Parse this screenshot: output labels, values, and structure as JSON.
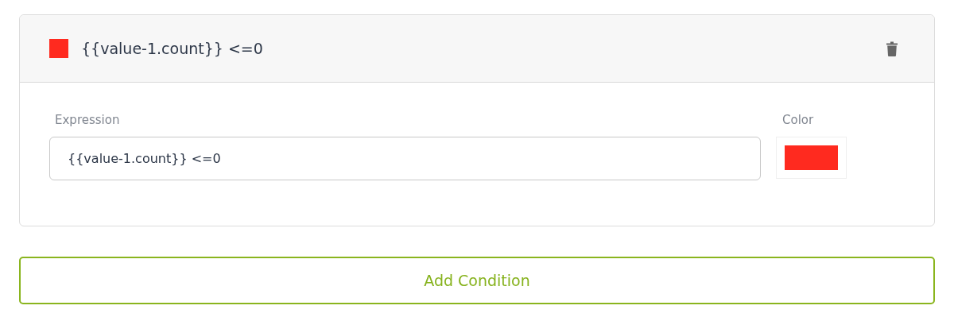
{
  "conditions": [
    {
      "title": "{{value-1.count}} <=0",
      "color": "#ff2a1f",
      "expression_label": "Expression",
      "expression": "{{value-1.count}} <=0",
      "color_label": "Color"
    }
  ],
  "add_button": "Add Condition"
}
